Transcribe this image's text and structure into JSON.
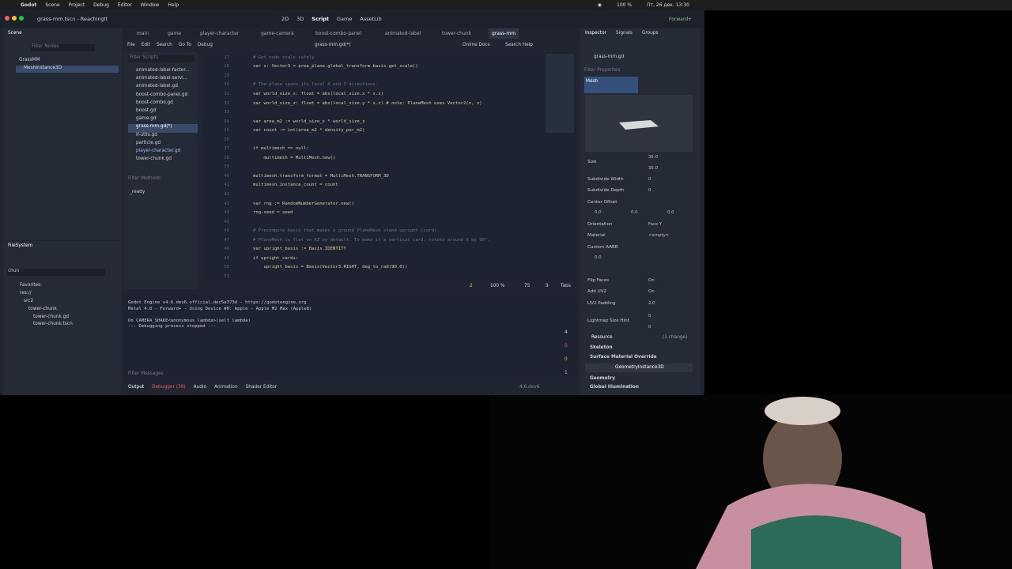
{
  "menubar": {
    "apple": "",
    "app": "Godot",
    "items": [
      "Scene",
      "Project",
      "Debug",
      "Editor",
      "Window",
      "Help"
    ],
    "battery": "100 %",
    "datetime": "Пт, 26 дек. 13:30"
  },
  "titlebar": {
    "file": "grass-mm.tscn - ReachingIt",
    "modes": [
      "2D",
      "3D",
      "Script",
      "Game",
      "AssetLib"
    ],
    "renderer": "Forward+"
  },
  "scene_dock": {
    "title": "Scene",
    "filter": "Filter Nodes",
    "nodes": [
      "GrassMM",
      "MeshInstance3D"
    ]
  },
  "script_tabs": [
    "main",
    "game",
    "player-character",
    "game-camera",
    "boost-combo-panel",
    "animated-label",
    "tower-chunk",
    "grass-mm"
  ],
  "script_menu": [
    "File",
    "Edit",
    "Search",
    "Go To",
    "Debug"
  ],
  "script_title": "grass-mm.gd(*)",
  "script_links": [
    "Online Docs",
    "Search Help"
  ],
  "filter_scripts": "Filter Scripts",
  "scripts": [
    "animated-label-factor...",
    "animated-label-servi...",
    "animated-label.gd",
    "boost-combo-panel.gd",
    "boost-combo.gd",
    "boost.gd",
    "game.gd",
    "grass-mm.gd(*)",
    "if-utils.gd",
    "particle.gd",
    "player-character.gd",
    "tower-chunk.gd"
  ],
  "filter_methods": "Filter Methods",
  "methods": [
    "_ready"
  ],
  "code_lines": [
    {
      "n": "27",
      "t": "# Get node scale safely",
      "c": "cm"
    },
    {
      "n": "28",
      "t": "var s: Vector3 = area_plane.global_transform.basis.get_scale()",
      "c": "kw"
    },
    {
      "n": "29",
      "t": "",
      "c": ""
    },
    {
      "n": "30",
      "t": "# The plane spans its local X and Z directions.",
      "c": "cm"
    },
    {
      "n": "31",
      "t": "var world_size_x: float = abs(local_size.x * s.x)",
      "c": "kw"
    },
    {
      "n": "32",
      "t": "var world_size_z: float = abs(local_size.y * s.z) # note: PlaneMesh uses Vector2(x, z)",
      "c": "kw"
    },
    {
      "n": "33",
      "t": "",
      "c": ""
    },
    {
      "n": "34",
      "t": "var area_m2 := world_size_x * world_size_z",
      "c": "kw"
    },
    {
      "n": "35",
      "t": "var count := int(area_m2 * density_per_m2)",
      "c": "kw"
    },
    {
      "n": "36",
      "t": "",
      "c": ""
    },
    {
      "n": "37",
      "t": "if multimesh == null:",
      "c": "kw"
    },
    {
      "n": "38",
      "t": "    multimesh = MultiMesh.new()",
      "c": "kw"
    },
    {
      "n": "39",
      "t": "",
      "c": ""
    },
    {
      "n": "40",
      "t": "multimesh.transform_format = MultiMesh.TRANSFORM_3D",
      "c": "kw"
    },
    {
      "n": "41",
      "t": "multimesh.instance_count = count",
      "c": "kw"
    },
    {
      "n": "42",
      "t": "",
      "c": ""
    },
    {
      "n": "43",
      "t": "var rng := RandomNumberGenerator.new()",
      "c": "kw"
    },
    {
      "n": "44",
      "t": "rng.seed = seed",
      "c": "kw"
    },
    {
      "n": "45",
      "t": "",
      "c": ""
    },
    {
      "n": "46",
      "t": "# Precompute basis that makes a ground PlaneMesh stand upright (card).",
      "c": "cm"
    },
    {
      "n": "47",
      "t": "# PlaneMesh is flat on XZ by default. To make it a vertical card, rotate around X by 90°.",
      "c": "cm"
    },
    {
      "n": "48",
      "t": "var upright_basis := Basis.IDENTITY",
      "c": "kw"
    },
    {
      "n": "49",
      "t": "if upright_cards:",
      "c": "kw"
    },
    {
      "n": "50",
      "t": "    upright_basis = Basis(Vector3.RIGHT, deg_to_rad(90.0))",
      "c": "kw"
    },
    {
      "n": "51",
      "t": "",
      "c": ""
    }
  ],
  "status": {
    "warnings": "2",
    "zoom": "100 %",
    "line": "75",
    "col": "9",
    "indent": "Tabs"
  },
  "output_lines": [
    "Godot Engine v4.6.dev6.official.dec5a373d - https://godotengine.org",
    "Metal 4.0 - Forward+ - Using Device #0: Apple - Apple M2 Max (Apple8)",
    "",
    "On CAMERA_SHAKE<anonymous lambda>(self lambda)",
    "--- Debugging process stopped ---"
  ],
  "output_counts": [
    "4",
    "0",
    "0",
    "1"
  ],
  "filter_messages": "Filter Messages",
  "bottom_tabs": [
    "Output",
    "Debugger (39)",
    "Audio",
    "Animation",
    "Shader Editor"
  ],
  "version": "4.6.dev6",
  "filesystem": {
    "title": "FileSystem",
    "search": "chun",
    "items": [
      "Favorites:",
      "res://",
      "src2",
      "tower-chunk",
      "tower-chunk.gd",
      "tower-chunk.tscn"
    ]
  },
  "inspector": {
    "tabs": [
      "Inspector",
      "Signals",
      "Groups"
    ],
    "object": "grass-mm.gd",
    "filter": "Filter Properties",
    "mesh_label": "Mesh",
    "props": [
      {
        "k": "Size",
        "v": "35.0",
        "v2": "35.0"
      },
      {
        "k": "Subdivide Width",
        "v": "0"
      },
      {
        "k": "Subdivide Depth",
        "v": "0"
      },
      {
        "k": "Center Offset",
        "v": "0.0",
        "v2": "0.0",
        "v3": "0.0"
      },
      {
        "k": "Orientation",
        "v": "Face Y"
      },
      {
        "k": "Material",
        "v": "<empty>"
      },
      {
        "k": "Custom AABB",
        "v": "0.0"
      },
      {
        "k": "Flip Faces",
        "v": "On"
      },
      {
        "k": "Add UV2",
        "v": "On"
      },
      {
        "k": "UV2 Padding",
        "v": "2.0"
      },
      {
        "k": "Lightmap Size Hint",
        "v": "0",
        "v2": "0"
      }
    ],
    "resource": "Resource",
    "changes": "(1 change)",
    "sections": [
      "Skeleton",
      "Surface Material Override",
      "GeometryInstance3D",
      "Geometry",
      "Global Illumination"
    ]
  }
}
